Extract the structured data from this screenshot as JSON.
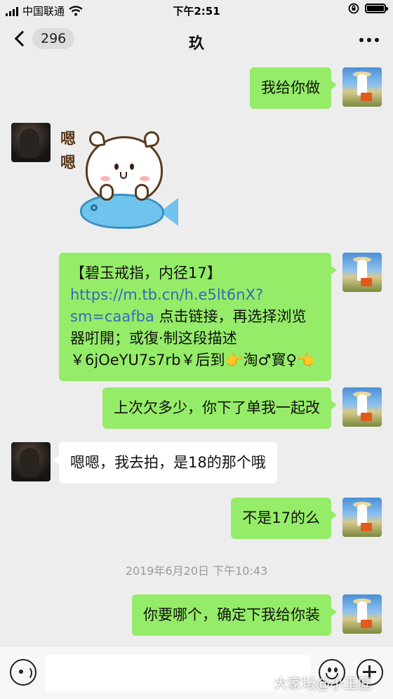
{
  "status_bar": {
    "carrier": "中国联通",
    "time": "下午2:51"
  },
  "nav": {
    "back_count": "296",
    "title": "玖"
  },
  "messages": [
    {
      "from": "me",
      "text": "我给你做"
    },
    {
      "from": "them",
      "type": "sticker",
      "sticker_text": [
        "嗯",
        "嗯"
      ]
    },
    {
      "from": "me",
      "parts": {
        "pre": "【碧玉戒指，内径17】 ",
        "link": "https://m.tb.cn/h.e5lt6nX?sm=caafba",
        "post": " 点击链接，再选择浏览器咑開；或復·制这段描述￥6jOeYU7s7rb￥后到👉淘♂寳♀👈"
      }
    },
    {
      "from": "me",
      "text": "上次欠多少，你下了单我一起改"
    },
    {
      "from": "them",
      "text": "嗯嗯，我去拍，是18的那个哦"
    },
    {
      "from": "me",
      "text": "不是17的么"
    },
    {
      "from": "me",
      "text": "你要哪个，确定下我给你装"
    }
  ],
  "timestamp": "2019年6月20日 下午10:43",
  "input_bar": {
    "placeholder": ""
  },
  "watermark": "大家坛@小玉匠"
}
